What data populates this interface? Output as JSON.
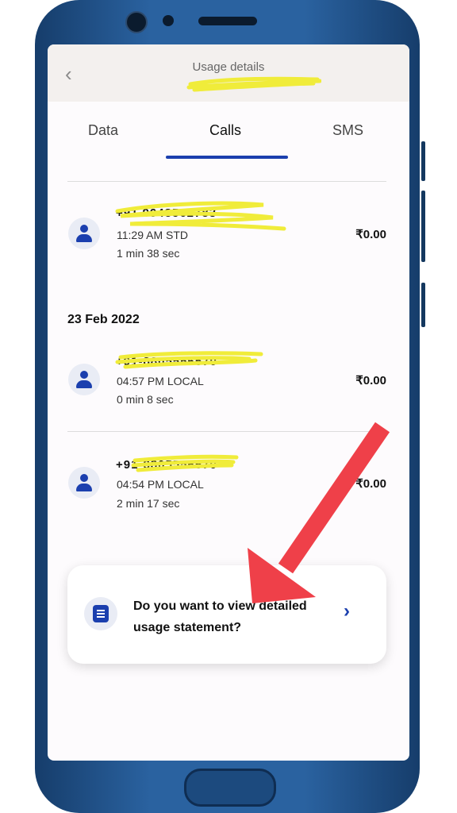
{
  "header": {
    "title": "Usage details",
    "back_icon": "chevron-left-icon"
  },
  "tabs": [
    {
      "label": "Data",
      "active": false
    },
    {
      "label": "Calls",
      "active": true
    },
    {
      "label": "SMS",
      "active": false
    }
  ],
  "calls": [
    {
      "number": "+91 9948562783",
      "time": "11:29 AM STD",
      "duration": "1 min 38 sec",
      "amount": "₹0.00"
    },
    {
      "number": "+91-8805556570",
      "time": "04:57 PM LOCAL",
      "duration": "0 min 8 sec",
      "amount": "₹0.00"
    },
    {
      "number": "+91-8805556570",
      "time": "04:54 PM LOCAL",
      "duration": "2 min 17 sec",
      "amount": "₹0.00"
    }
  ],
  "date_group": "23 Feb 2022",
  "statement_card": {
    "text": "Do you want to view detailed usage statement?",
    "icon": "document-list-icon"
  },
  "colors": {
    "accent": "#1b3fae",
    "highlight": "#f0ec3a",
    "annotation_arrow": "#ef4049",
    "phone_body": "#1f4f86"
  }
}
